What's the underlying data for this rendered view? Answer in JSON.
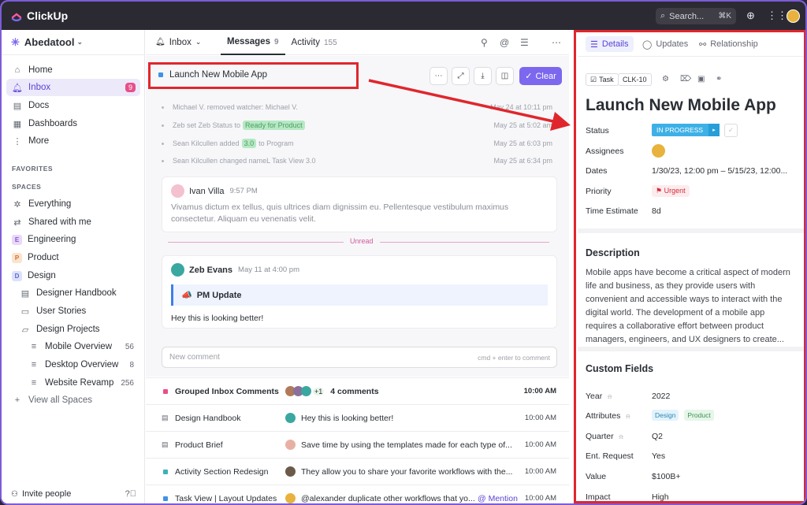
{
  "topbar": {
    "app_name": "ClickUp",
    "search_placeholder": "Search...",
    "search_shortcut": "⌘K"
  },
  "sidebar": {
    "workspace": "Abedatool",
    "nav": [
      {
        "label": "Home",
        "icon": "home-icon"
      },
      {
        "label": "Inbox",
        "icon": "bell-icon",
        "badge": "9"
      },
      {
        "label": "Docs",
        "icon": "doc-icon"
      },
      {
        "label": "Dashboards",
        "icon": "dashboard-icon"
      },
      {
        "label": "More",
        "icon": "more-icon"
      }
    ],
    "favorites_label": "FAVORITES",
    "spaces_label": "SPACES",
    "spaces": [
      {
        "label": "Everything"
      },
      {
        "label": "Shared with me"
      },
      {
        "label": "Engineering",
        "initial": "E",
        "color": "#e8d9f8",
        "fg": "#8b4fd1"
      },
      {
        "label": "Product",
        "initial": "P",
        "color": "#fbe4cf",
        "fg": "#d0722e"
      },
      {
        "label": "Design",
        "initial": "D",
        "color": "#dde2fb",
        "fg": "#5b6ad6"
      }
    ],
    "folders": [
      {
        "label": "Designer Handbook"
      },
      {
        "label": "User Stories"
      },
      {
        "label": "Design  Projects"
      }
    ],
    "lists": [
      {
        "label": "Mobile Overview",
        "count": "56"
      },
      {
        "label": "Desktop Overview",
        "count": "8"
      },
      {
        "label": "Website Revamp",
        "count": "256"
      }
    ],
    "view_all": "View all Spaces",
    "invite": "Invite people"
  },
  "inbox": {
    "label": "Inbox",
    "tabs": [
      {
        "label": "Messages",
        "count": "9"
      },
      {
        "label": "Activity",
        "count": "155"
      }
    ]
  },
  "thread": {
    "title": "Launch New Mobile App",
    "clear_label": "Clear",
    "history": [
      {
        "text": "Michael V. removed watcher: Michael V.",
        "time": "May 24 at 10:11 pm"
      },
      {
        "pre": "Zeb set Zeb Status to",
        "tag": "Ready for Product",
        "post": "",
        "time": "May 25 at 5:02 am"
      },
      {
        "pre": "Sean Kilcullen added",
        "tag": "3.0",
        "post": "to Program",
        "time": "May 25 at 6:03 pm"
      },
      {
        "text": "Sean Kilcullen changed nameL Task View 3.0",
        "time": "May 25 at 6:34 pm"
      }
    ],
    "message1": {
      "author": "Ivan Villa",
      "time": "9:57 PM",
      "body": "Vivamus dictum ex tellus, quis ultrices diam dignissim eu. Pellentesque vestibulum maximus consectetur. Aliquam eu venenatis velit."
    },
    "unread_label": "Unread",
    "message2": {
      "author": "Zeb Evans",
      "time": "May 11 at 4:00 pm",
      "quote": "PM Update",
      "quote_emoji": "📣",
      "reply": "Hey this is looking better!"
    },
    "comment_placeholder": "New comment",
    "comment_hint": "cmd + enter to comment"
  },
  "list": [
    {
      "name": "Grouped Inbox Comments",
      "preview": "4 comments",
      "extra": "+1",
      "time": "10:00 AM",
      "kind": "square",
      "color": "#e84f88",
      "bold": true
    },
    {
      "name": "Design Handbook",
      "preview": "Hey this is looking better!",
      "time": "10:00 AM",
      "kind": "doc"
    },
    {
      "name": "Product Brief",
      "preview": "Save time by using the templates made for each type of...",
      "time": "10:00 AM",
      "kind": "doc"
    },
    {
      "name": "Activity Section Redesign",
      "preview": "They allow you to share your favorite workflows with the...",
      "time": "10:00 AM",
      "kind": "square",
      "color": "#3db0b9"
    },
    {
      "name": "Task View | Layout Updates",
      "preview": "@alexander duplicate other workflows that yo...",
      "mention": "@ Mention",
      "time": "10:00 AM",
      "kind": "square",
      "color": "#3e93e6"
    }
  ],
  "detail": {
    "tabs": [
      "Details",
      "Updates",
      "Relationship"
    ],
    "task_type": "Task",
    "task_id": "CLK-10",
    "title": "Launch New Mobile App",
    "props": [
      {
        "label": "Status",
        "value": "IN PROGRESS"
      },
      {
        "label": "Assignees",
        "value": ""
      },
      {
        "label": "Dates",
        "value": "1/30/23, 12:00 pm – 5/15/23, 12:00..."
      },
      {
        "label": "Priority",
        "value": "Urgent"
      },
      {
        "label": "Time Estimate",
        "value": "8d"
      }
    ],
    "description_heading": "Description",
    "description": "Mobile apps have become a critical aspect of modern life and business, as they provide users with convenient and accessible ways to interact with the digital world. The development of a mobile app requires a collaborative effort between product managers, engineers, and UX designers to create...",
    "custom_heading": "Custom Fields",
    "custom": [
      {
        "label": "Year",
        "value": "2022"
      },
      {
        "label": "Attributes",
        "pills": [
          "Design",
          "Product"
        ]
      },
      {
        "label": "Quarter",
        "value": "Q2"
      },
      {
        "label": "Ent. Request",
        "value": "Yes"
      },
      {
        "label": "Value",
        "value": "$100B+"
      },
      {
        "label": "Impact",
        "value": "High"
      }
    ]
  },
  "colors": {
    "accent": "#7b68ee",
    "annotation_red": "#e0262d",
    "status_blue": "#3db0e6"
  }
}
